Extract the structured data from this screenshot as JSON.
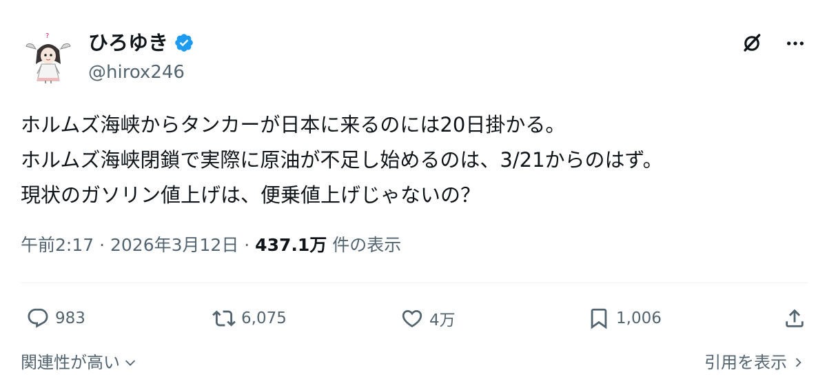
{
  "author": {
    "display_name": "ひろゆき",
    "handle": "@hirox246",
    "verified": true,
    "verified_color": "#1d9bf0",
    "avatar_icon": "avatar-anime-character"
  },
  "top_actions": {
    "grok_icon": "grok-icon",
    "more_icon": "more-dots-icon"
  },
  "tweet": {
    "lines": [
      "ホルムズ海峡からタンカーが日本に来るのには20日掛かる。",
      "ホルムズ海峡閉鎖で実際に原油が不足し始めるのは、3/21からのはず。",
      "現状のガソリン値上げは、便乗値上げじゃないの？"
    ]
  },
  "meta": {
    "time": "午前2:17",
    "separator": " · ",
    "date": "2026年3月12日",
    "views_count": "437.1万",
    "views_label": " 件の表示"
  },
  "actions": {
    "reply": {
      "icon": "reply-icon",
      "count": "983"
    },
    "retweet": {
      "icon": "retweet-icon",
      "count": "6,075"
    },
    "like": {
      "icon": "heart-icon",
      "count": "4万"
    },
    "bookmark": {
      "icon": "bookmark-icon",
      "count": "1,006"
    },
    "share": {
      "icon": "share-icon"
    }
  },
  "footer": {
    "sort_label": "関連性が高い",
    "quotes_label": "引用を表示"
  },
  "colors": {
    "text_primary": "#0f1419",
    "text_secondary": "#536471",
    "divider": "#eff3f4",
    "accent": "#1d9bf0"
  }
}
